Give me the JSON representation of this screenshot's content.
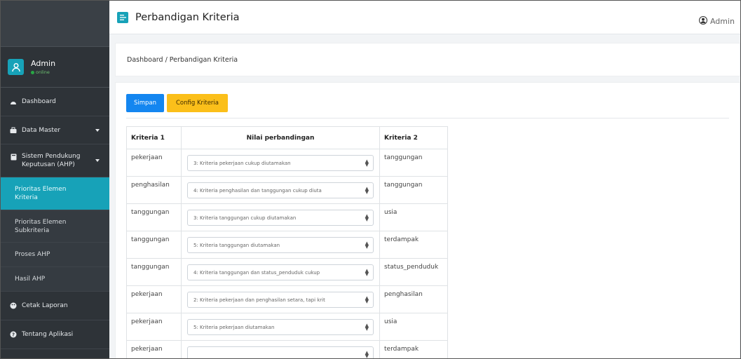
{
  "topbar": {
    "title": "Perbandigan Kriteria",
    "user": "Admin"
  },
  "sidebar": {
    "user": {
      "name": "Admin",
      "status": "online"
    },
    "items": [
      {
        "label": "Dashboard"
      },
      {
        "label": "Data Master"
      },
      {
        "label": "Sistem Pendukung Keputusan (AHP)"
      },
      {
        "label": "Cetak Laporan"
      },
      {
        "label": "Tentang Aplikasi"
      }
    ],
    "subitems": [
      {
        "label": "Prioritas Elemen Kriteria"
      },
      {
        "label": "Prioritas Elemen Subkriteria"
      },
      {
        "label": "Proses AHP"
      },
      {
        "label": "Hasil AHP"
      }
    ]
  },
  "breadcrumb": {
    "home": "Dashboard",
    "separator": " / ",
    "current": "Perbandigan Kriteria"
  },
  "toolbar": {
    "save_label": "Simpan",
    "config_label": "Config Kriteria"
  },
  "table": {
    "headers": [
      "Kriteria 1",
      "Nilai perbandingan",
      "Kriteria 2"
    ],
    "rows": [
      {
        "k1": "pekerjaan",
        "value": "3: Kriteria pekerjaan cukup diutamakan",
        "k2": "tanggungan"
      },
      {
        "k1": "penghasilan",
        "value": "4: Kriteria penghasilan dan tanggungan cukup diuta",
        "k2": "tanggungan"
      },
      {
        "k1": "tanggungan",
        "value": "3: Kriteria tanggungan cukup diutamakan",
        "k2": "usia"
      },
      {
        "k1": "tanggungan",
        "value": "5: Kriteria tanggungan diutamakan",
        "k2": "terdampak"
      },
      {
        "k1": "tanggungan",
        "value": "4: Kriteria tanggungan dan status_penduduk cukup",
        "k2": "status_penduduk"
      },
      {
        "k1": "pekerjaan",
        "value": "2: Kriteria pekerjaan dan penghasilan setara, tapi krit",
        "k2": "penghasilan"
      },
      {
        "k1": "pekerjaan",
        "value": "5: Kriteria pekerjaan diutamakan",
        "k2": "usia"
      },
      {
        "k1": "pekerjaan",
        "value": "",
        "k2": "terdampak"
      }
    ]
  },
  "colors": {
    "sidebar_bg": "#2e3338",
    "accent": "#17a2b8",
    "primary": "#1486f0",
    "warning": "#fbbf1a"
  }
}
